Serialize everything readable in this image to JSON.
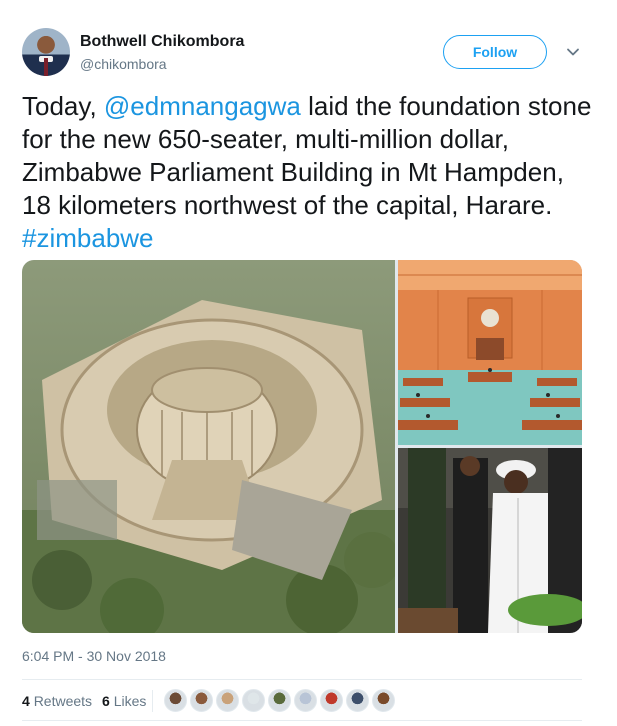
{
  "author": {
    "name": "Bothwell Chikombora",
    "handle": "@chikombora"
  },
  "follow_label": "Follow",
  "tweet": {
    "text_before": "Today, ",
    "mention": "@edmnangagwa",
    "text_middle": " laid the foundation stone for the new 650-seater, multi-million dollar, Zimbabwe Parliament Building in Mt Hampden, 18 kilometers northwest of the capital, Harare. ",
    "hashtag": "#zimbabwe"
  },
  "timestamp": "6:04 PM - 30 Nov 2018",
  "stats": {
    "retweets_count": "4",
    "retweets_label": "Retweets",
    "likes_count": "6",
    "likes_label": "Likes"
  },
  "likers": [
    {
      "color": "#6b4a35"
    },
    {
      "color": "#8a5a3c"
    },
    {
      "color": "#c9a27a"
    },
    {
      "color": "#dfe6e9"
    },
    {
      "color": "#5a6b3c"
    },
    {
      "color": "#b8c4d6"
    },
    {
      "color": "#c0392b"
    },
    {
      "color": "#3d4f6b"
    },
    {
      "color": "#7a4a2a"
    }
  ],
  "colors": {
    "accent": "#1da1f2",
    "link": "#1b95e0",
    "text": "#14171a",
    "muted": "#657786"
  }
}
